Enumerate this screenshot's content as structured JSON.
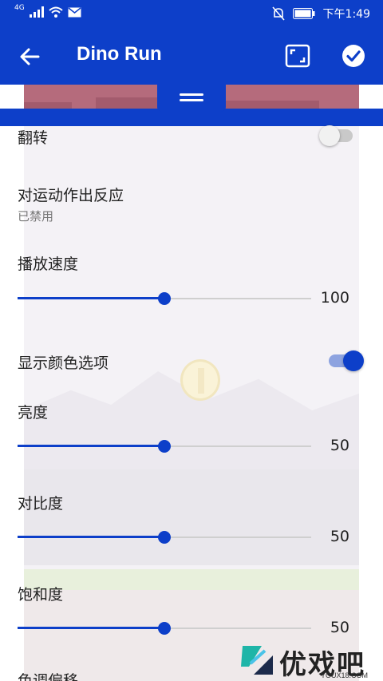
{
  "status_bar": {
    "network": "4G",
    "time": "下午1:49",
    "icons": [
      "signal-icon",
      "wifi-icon",
      "mail-icon",
      "mute-bell-icon",
      "battery-icon"
    ]
  },
  "app_bar": {
    "title": "Dino Run",
    "icons": [
      "back-arrow-icon",
      "fullscreen-frame-icon",
      "check-circle-icon"
    ]
  },
  "settings": {
    "flip": {
      "label": "翻转",
      "enabled": false
    },
    "motion": {
      "label": "对运动作出反应",
      "subtitle": "已禁用"
    },
    "playback_speed": {
      "label": "播放速度",
      "value": "100",
      "fraction": 0.5
    },
    "show_color_options": {
      "label": "显示颜色选项",
      "enabled": true
    },
    "brightness": {
      "label": "亮度",
      "value": "50",
      "fraction": 0.5
    },
    "contrast": {
      "label": "对比度",
      "value": "50",
      "fraction": 0.5
    },
    "saturation": {
      "label": "饱和度",
      "value": "50",
      "fraction": 0.5
    },
    "hue_shift": {
      "label": "色调偏移"
    }
  },
  "watermark": {
    "text": "优戏吧",
    "sub": "YOUX18.COM"
  },
  "colors": {
    "primary": "#0d3fc9",
    "track": "#cfcfcf"
  }
}
